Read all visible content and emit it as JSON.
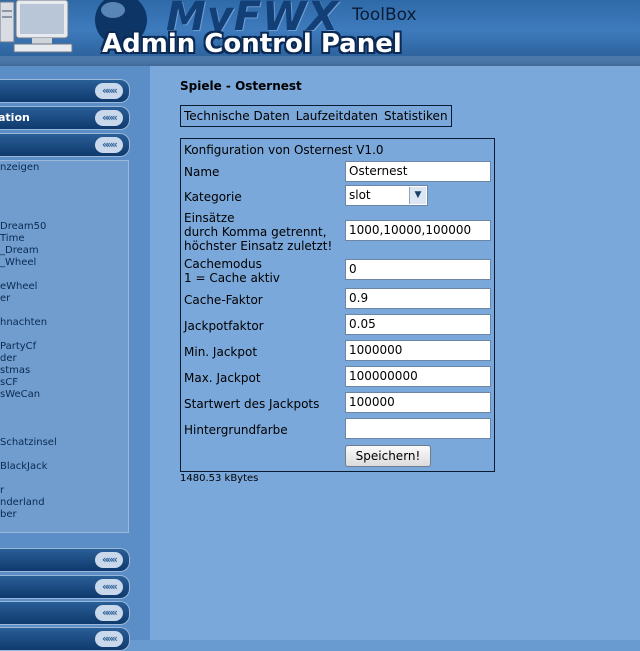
{
  "header": {
    "logo_text": "MyFWX",
    "toolbox_label": "ToolBox",
    "panel_title": "Admin Control Panel"
  },
  "sidebar": {
    "bars": [
      {
        "label": ""
      },
      {
        "label": "ation"
      },
      {
        "label": ""
      },
      {
        "label": ""
      },
      {
        "label": ""
      },
      {
        "label": ""
      },
      {
        "label": ""
      }
    ],
    "chevron": "«««",
    "games": [
      "nzeigen",
      "Dream50",
      "Time",
      "_Dream",
      "_Wheel",
      "eWheel",
      "er",
      "hnachten",
      "PartyCf",
      "der",
      "stmas",
      "sCF",
      "sWeCan",
      "Schatzinsel",
      "BlackJack",
      "r",
      "nderland",
      "ber"
    ]
  },
  "main": {
    "page_title": "Spiele - Osternest",
    "tabs": [
      "Technische Daten",
      "Laufzeitdaten",
      "Statistiken"
    ],
    "config_title": "Konfiguration von Osternest V1.0",
    "fields": [
      {
        "label": "Name",
        "value": "Osternest"
      },
      {
        "label": "Kategorie",
        "value": "slot"
      },
      {
        "label_lines": [
          "Einsätze",
          "durch Komma getrennt,",
          "höchster Einsatz zuletzt!"
        ],
        "value": "1000,10000,100000"
      },
      {
        "label_lines": [
          "Cachemodus",
          "1 = Cache aktiv"
        ],
        "value": "0"
      },
      {
        "label": "Cache-Faktor",
        "value": "0.9"
      },
      {
        "label": "Jackpotfaktor",
        "value": "0.05"
      },
      {
        "label": "Min. Jackpot",
        "value": "1000000"
      },
      {
        "label": "Max. Jackpot",
        "value": "100000000"
      },
      {
        "label": "Startwert des Jackpots",
        "value": "100000"
      },
      {
        "label": "Hintergrundfarbe",
        "value": ""
      }
    ],
    "save_button": "Speichern!",
    "memory_usage": "1480.53 kBytes"
  },
  "colors": {
    "background": "#6a9bd0",
    "header": "#2f6aa8",
    "sidebar_bar": "#0e3a6d"
  }
}
